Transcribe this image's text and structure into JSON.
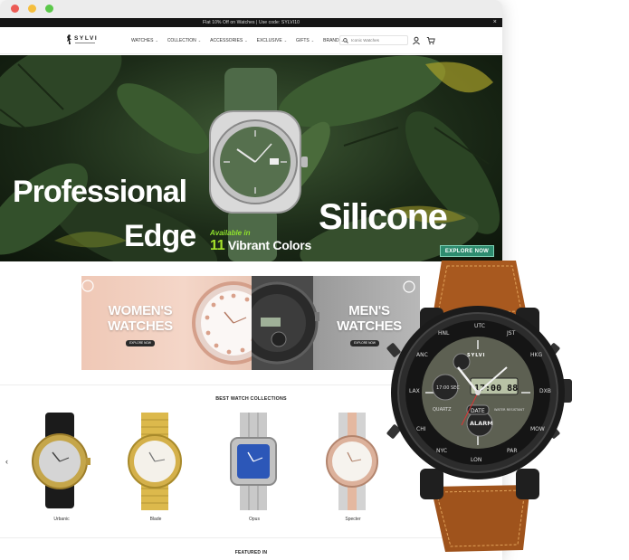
{
  "announcement": {
    "text": "Flat 10% Off on Watches | Use code: SYLVI10",
    "close": "×"
  },
  "brand": {
    "name": "SYLVI"
  },
  "nav": {
    "items": [
      {
        "label": "WATCHES"
      },
      {
        "label": "COLLECTION"
      },
      {
        "label": "ACCESSORIES"
      },
      {
        "label": "EXCLUSIVE"
      },
      {
        "label": "GIFTS"
      },
      {
        "label": "BRAND"
      }
    ],
    "caret": "⌄"
  },
  "search": {
    "placeholder": "Iconic Watches"
  },
  "hero": {
    "line1": "Professional",
    "line2": "Edge",
    "line3": "Silicone",
    "available": "Available in",
    "count": "11",
    "colors": "Vibrant Colors",
    "cta": "EXPLORE NOW"
  },
  "banners": {
    "women": {
      "title_line1": "WOMEN'S",
      "title_line2": "WATCHES",
      "button": "EXPLORE NOW"
    },
    "men": {
      "title_line1": "MEN'S",
      "title_line2": "WATCHES",
      "button": "EXPLORE NOW"
    }
  },
  "collections": {
    "heading": "BEST WATCH COLLECTIONS",
    "prev_arrow": "‹",
    "products": [
      {
        "name": "Urbanic"
      },
      {
        "name": "Blade"
      },
      {
        "name": "Opus"
      },
      {
        "name": "Specter"
      }
    ]
  },
  "featured": {
    "heading": "FEATURED IN"
  },
  "big_watch": {
    "brand": "SYLVI",
    "digital_time": "17:00 88",
    "small_sub": "17:00 SEC",
    "date_label": "DATE",
    "alarm_label": "ALARM",
    "quartz": "QUARTZ",
    "water": "WATER RESISTANT"
  },
  "colors": {
    "hero_green": "#2e8c6f",
    "announce_bg": "#151515",
    "strap_brown": "#a8591f"
  }
}
